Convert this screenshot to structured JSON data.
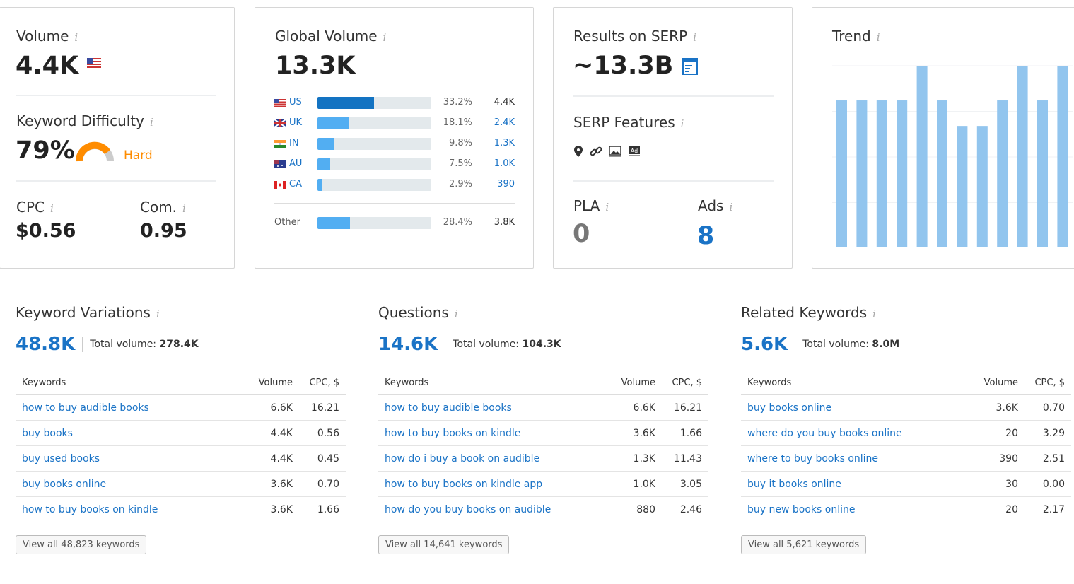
{
  "volume": {
    "title": "Volume",
    "value": "4.4K",
    "flag": "us"
  },
  "kd": {
    "title": "Keyword Difficulty",
    "value": "79%",
    "level": "Hard",
    "percent": 79,
    "color": "#ff8c00"
  },
  "cpc": {
    "title": "CPC",
    "value": "$0.56"
  },
  "com": {
    "title": "Com.",
    "value": "0.95"
  },
  "global": {
    "title": "Global Volume",
    "value": "13.3K",
    "rows": [
      {
        "code": "US",
        "pct": "33.2%",
        "val": "4.4K",
        "share": 33.2
      },
      {
        "code": "UK",
        "pct": "18.1%",
        "val": "2.4K",
        "share": 18.1
      },
      {
        "code": "IN",
        "pct": "9.8%",
        "val": "1.3K",
        "share": 9.8
      },
      {
        "code": "AU",
        "pct": "7.5%",
        "val": "1.0K",
        "share": 7.5
      },
      {
        "code": "CA",
        "pct": "2.9%",
        "val": "390",
        "share": 2.9
      }
    ],
    "other": {
      "label": "Other",
      "pct": "28.4%",
      "val": "3.8K",
      "share": 28.4
    }
  },
  "serp": {
    "title": "Results on SERP",
    "value": "~13.3B",
    "features_title": "SERP Features",
    "features": [
      "map-pin-icon",
      "link-icon",
      "image-icon",
      "ad-icon"
    ]
  },
  "pla": {
    "title": "PLA",
    "value": "0"
  },
  "ads": {
    "title": "Ads",
    "value": "8"
  },
  "trend": {
    "title": "Trend",
    "values": [
      0.81,
      0.81,
      0.81,
      0.81,
      1.0,
      0.81,
      0.67,
      0.67,
      0.81,
      1.0,
      0.81,
      1.0
    ],
    "color": "#92c5ee"
  },
  "sections": [
    {
      "title": "Keyword Variations",
      "count": "48.8K",
      "total_label": "Total volume:",
      "total": "278.4K",
      "headers": [
        "Keywords",
        "Volume",
        "CPC, $"
      ],
      "rows": [
        [
          "how to buy audible books",
          "6.6K",
          "16.21"
        ],
        [
          "buy books",
          "4.4K",
          "0.56"
        ],
        [
          "buy used books",
          "4.4K",
          "0.45"
        ],
        [
          "buy books online",
          "3.6K",
          "0.70"
        ],
        [
          "how to buy books on kindle",
          "3.6K",
          "1.66"
        ]
      ],
      "view_all": "View all 48,823 keywords"
    },
    {
      "title": "Questions",
      "count": "14.6K",
      "total_label": "Total volume:",
      "total": "104.3K",
      "headers": [
        "Keywords",
        "Volume",
        "CPC, $"
      ],
      "rows": [
        [
          "how to buy audible books",
          "6.6K",
          "16.21"
        ],
        [
          "how to buy books on kindle",
          "3.6K",
          "1.66"
        ],
        [
          "how do i buy a book on audible",
          "1.3K",
          "11.43"
        ],
        [
          "how to buy books on kindle app",
          "1.0K",
          "3.05"
        ],
        [
          "how do you buy books on audible",
          "880",
          "2.46"
        ]
      ],
      "view_all": "View all 14,641 keywords"
    },
    {
      "title": "Related Keywords",
      "count": "5.6K",
      "total_label": "Total volume:",
      "total": "8.0M",
      "headers": [
        "Keywords",
        "Volume",
        "CPC, $"
      ],
      "rows": [
        [
          "buy books online",
          "3.6K",
          "0.70"
        ],
        [
          "where do you buy books online",
          "20",
          "3.29"
        ],
        [
          "where to buy books online",
          "390",
          "2.51"
        ],
        [
          "buy it books online",
          "30",
          "0.00"
        ],
        [
          "buy new books online",
          "20",
          "2.17"
        ]
      ],
      "view_all": "View all 5,621 keywords"
    }
  ]
}
